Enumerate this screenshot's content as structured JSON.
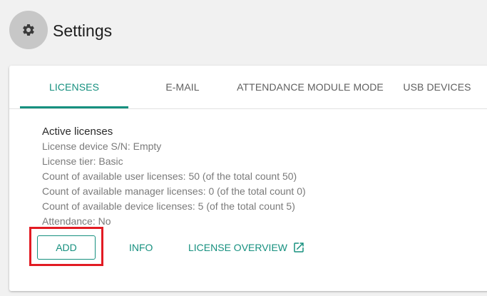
{
  "header": {
    "title": "Settings",
    "icon": "gear-icon"
  },
  "tabs": [
    {
      "label": "LICENSES",
      "active": true
    },
    {
      "label": "E-MAIL",
      "active": false
    },
    {
      "label": "ATTENDANCE MODULE MODE",
      "active": false
    },
    {
      "label": "USB DEVICES",
      "active": false
    }
  ],
  "licenses": {
    "section_title": "Active licenses",
    "lines": [
      "License device S/N: Empty",
      "License tier: Basic",
      "Count of available user licenses: 50 (of the total count 50)",
      "Count of available manager licenses: 0 (of the total count 0)",
      "Count of available device licenses: 5 (of the total count 5)",
      "Attendance: No"
    ],
    "buttons": {
      "add": "ADD",
      "info": "INFO",
      "overview": "LICENSE OVERVIEW",
      "overview_icon": "external-link-icon"
    }
  },
  "colors": {
    "accent": "#16907f",
    "highlight": "#e21b23",
    "background": "#f1f1f1"
  }
}
